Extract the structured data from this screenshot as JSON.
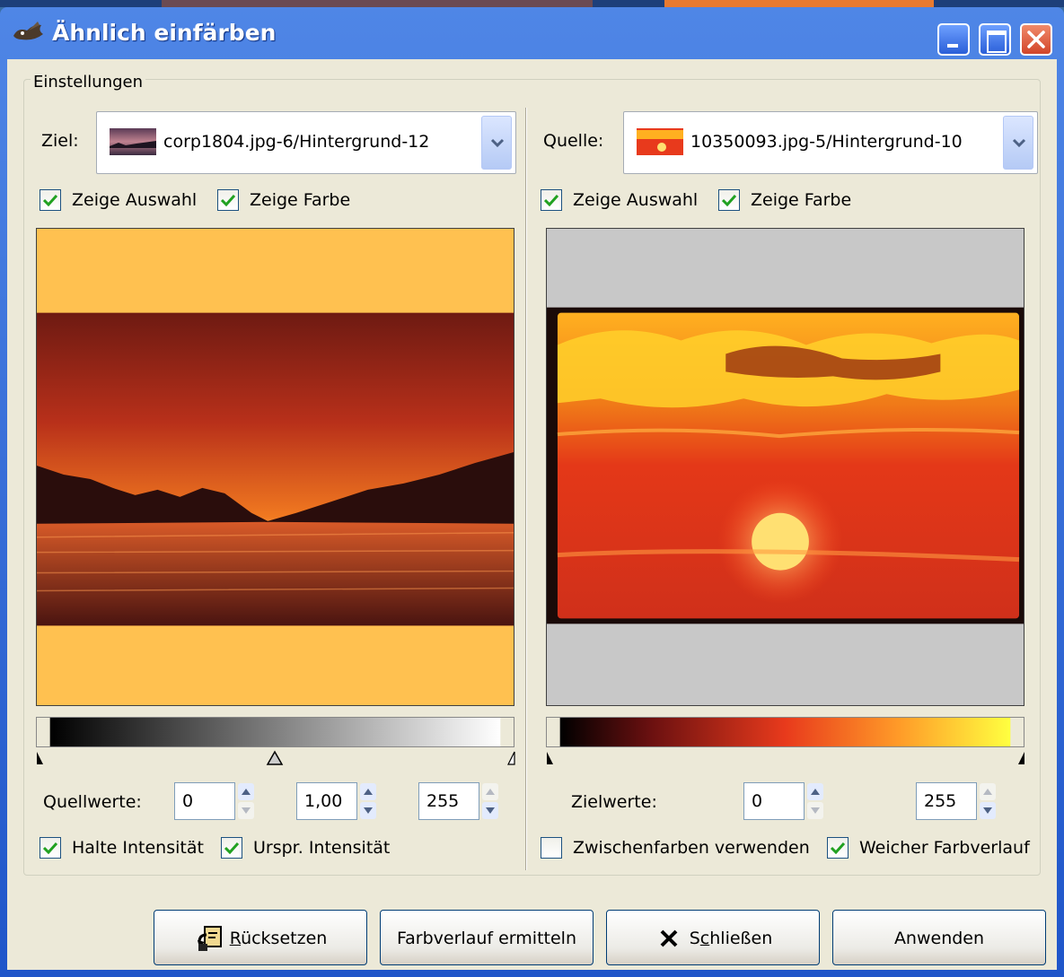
{
  "window": {
    "title": "Ähnlich einfärben"
  },
  "group": {
    "label": "Einstellungen"
  },
  "target": {
    "label": "Ziel:",
    "image": "corp1804.jpg-6/Hintergrund-12",
    "show_selection": "Zeige Auswahl",
    "show_color": "Zeige Farbe",
    "values_label": "Quellwerte:",
    "low": "0",
    "gamma": "1,00",
    "high": "255",
    "keep_intensity": "Halte Intensität",
    "orig_intensity": "Urspr. Intensität"
  },
  "source": {
    "label": "Quelle:",
    "image": "10350093.jpg-5/Hintergrund-10",
    "show_selection": "Zeige Auswahl",
    "show_color": "Zeige Farbe",
    "values_label": "Zielwerte:",
    "low": "0",
    "high": "255",
    "use_subcolors": "Zwischenfarben verwenden",
    "smooth_gradient": "Weicher Farbverlauf"
  },
  "checkbox_state": {
    "target_show_selection": true,
    "target_show_color": true,
    "source_show_selection": true,
    "source_show_color": true,
    "keep_intensity": true,
    "orig_intensity": true,
    "use_subcolors": false,
    "smooth_gradient": true
  },
  "buttons": {
    "reset_underline": "R",
    "reset_rest": "ücksetzen",
    "get_colors": "Farbverlauf ermitteln",
    "close_pre": "S",
    "close_underline": "c",
    "close_rest": "hließen",
    "apply": "Anwenden"
  },
  "colors": {
    "title_bar": "#2458d0",
    "dialog_bg": "#ece9d8",
    "target_bg": "#ffc150",
    "source_bg": "#c8c8c8"
  }
}
